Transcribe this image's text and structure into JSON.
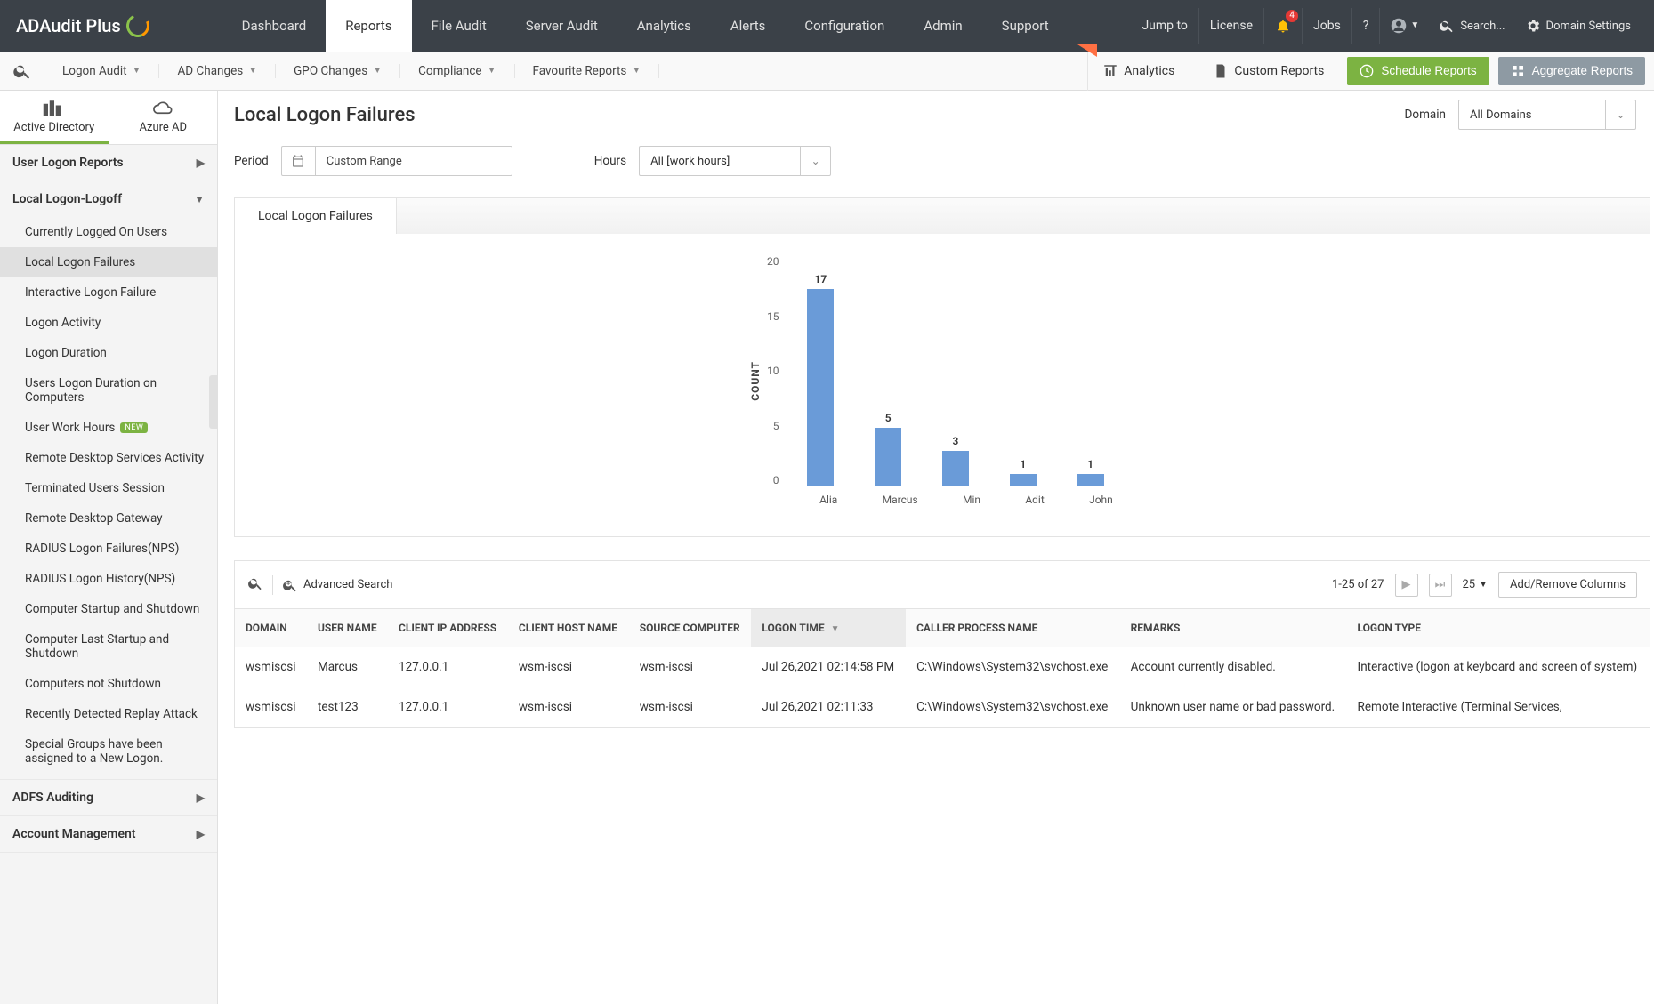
{
  "brand": "ADAudit Plus",
  "top_right": {
    "jump_to": "Jump to",
    "license": "License",
    "notif_count": "4",
    "jobs": "Jobs",
    "help": "?",
    "search_placeholder": "Search...",
    "domain_settings": "Domain Settings"
  },
  "main_nav": [
    "Dashboard",
    "Reports",
    "File Audit",
    "Server Audit",
    "Analytics",
    "Alerts",
    "Configuration",
    "Admin",
    "Support"
  ],
  "main_nav_active": 1,
  "sec_nav": {
    "items": [
      "Logon Audit",
      "AD Changes",
      "GPO Changes",
      "Compliance",
      "Favourite Reports"
    ],
    "analytics": "Analytics",
    "custom_reports": "Custom Reports",
    "schedule_reports": "Schedule Reports",
    "aggregate_reports": "Aggregate Reports"
  },
  "dir_tabs": {
    "ad": "Active Directory",
    "azure": "Azure AD"
  },
  "sidebar": {
    "groups": [
      {
        "title": "User Logon Reports",
        "expanded": false
      },
      {
        "title": "Local Logon-Logoff",
        "expanded": true,
        "items": [
          "Currently Logged On Users",
          "Local Logon Failures",
          "Interactive Logon Failure",
          "Logon Activity",
          "Logon Duration",
          "Users Logon Duration on Computers",
          "User Work Hours",
          "Remote Desktop Services Activity",
          "Terminated Users Session",
          "Remote Desktop Gateway",
          "RADIUS Logon Failures(NPS)",
          "RADIUS Logon History(NPS)",
          "Computer Startup and Shutdown",
          "Computer Last Startup and Shutdown",
          "Computers not Shutdown",
          "Recently Detected Replay Attack",
          "Special Groups have been assigned to a New Logon."
        ],
        "active_index": 1,
        "new_index": 6
      },
      {
        "title": "ADFS Auditing",
        "expanded": false
      },
      {
        "title": "Account Management",
        "expanded": false
      }
    ]
  },
  "page": {
    "title": "Local Logon Failures",
    "domain_label": "Domain",
    "domain_value": "All Domains",
    "period_label": "Period",
    "period_value": "Custom Range",
    "hours_label": "Hours",
    "hours_value": "All [work hours]",
    "tab": "Local Logon Failures"
  },
  "chart_data": {
    "type": "bar",
    "ylabel": "COUNT",
    "y_ticks": [
      20,
      15,
      10,
      5,
      0
    ],
    "ylim": [
      0,
      20
    ],
    "categories": [
      "Alia",
      "Marcus",
      "Min",
      "Adit",
      "John"
    ],
    "values": [
      17,
      5,
      3,
      1,
      1
    ]
  },
  "table": {
    "advanced_search": "Advanced Search",
    "range_text": "1-25 of 27",
    "page_size": "25",
    "add_remove": "Add/Remove Columns",
    "columns": [
      "DOMAIN",
      "USER NAME",
      "CLIENT IP ADDRESS",
      "CLIENT HOST NAME",
      "SOURCE COMPUTER",
      "LOGON TIME",
      "CALLER PROCESS NAME",
      "REMARKS",
      "LOGON TYPE"
    ],
    "sorted_col": 5,
    "rows": [
      {
        "c": [
          "wsmiscsi",
          "Marcus",
          "127.0.0.1",
          "wsm-iscsi",
          "wsm-iscsi",
          "Jul 26,2021 02:14:58 PM",
          "C:\\Windows\\System32\\svchost.exe",
          "Account currently disabled.",
          "Interactive (logon at keyboard and screen of system)"
        ]
      },
      {
        "c": [
          "wsmiscsi",
          "test123",
          "127.0.0.1",
          "wsm-iscsi",
          "wsm-iscsi",
          "Jul 26,2021 02:11:33",
          "C:\\Windows\\System32\\svchost.exe",
          "Unknown user name or bad password.",
          "Remote Interactive (Terminal Services,"
        ]
      }
    ]
  }
}
